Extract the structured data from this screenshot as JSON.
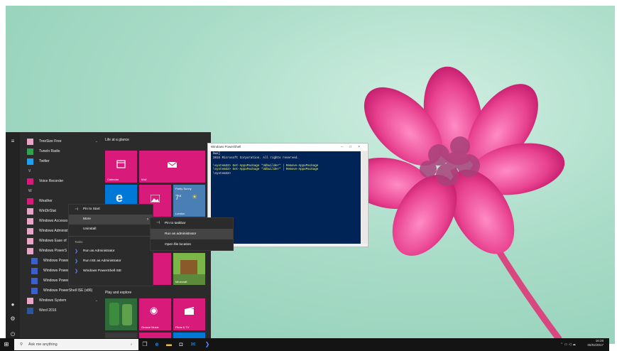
{
  "start_menu": {
    "app_list": [
      {
        "type": "app",
        "label": "TreeSize Free",
        "color": "#e8a5c8",
        "chevron": "⌄"
      },
      {
        "type": "app",
        "label": "Tuneln Radio",
        "color": "#2ea44f"
      },
      {
        "type": "app",
        "label": "Twitter",
        "color": "#1da1f2"
      },
      {
        "type": "letter",
        "label": "V"
      },
      {
        "type": "app",
        "label": "Voice Recorder",
        "color": "#d81b7a"
      },
      {
        "type": "letter",
        "label": "W"
      },
      {
        "type": "app",
        "label": "Weather",
        "color": "#d81b7a"
      },
      {
        "type": "app",
        "label": "WinDirStat",
        "color": "#e8a5c8"
      },
      {
        "type": "app",
        "label": "Windows Accesso",
        "color": "#e8a5c8"
      },
      {
        "type": "app",
        "label": "Windows Administ",
        "color": "#e8a5c8"
      },
      {
        "type": "app",
        "label": "Windows Ease of",
        "color": "#e8a5c8"
      },
      {
        "type": "app",
        "label": "Windows PowerS",
        "color": "#e8a5c8"
      },
      {
        "type": "app",
        "label": "Windows PowerShell",
        "color": "#3b5fcc",
        "indent": true
      },
      {
        "type": "app",
        "label": "Windows PowerShell (x86)",
        "color": "#3b5fcc",
        "indent": true
      },
      {
        "type": "app",
        "label": "Windows PowerShell ISE",
        "color": "#3b5fcc",
        "indent": true
      },
      {
        "type": "app",
        "label": "Windows PowerShell ISE (x86)",
        "color": "#3b5fcc",
        "indent": true
      },
      {
        "type": "app",
        "label": "Windows System",
        "color": "#e8a5c8",
        "chevron": "⌄"
      },
      {
        "type": "app",
        "label": "Word 2016",
        "color": "#2b579a"
      }
    ],
    "groups": {
      "life": "Life at a glance",
      "play": "Play and explore"
    },
    "tiles": {
      "calendar": "Calendar",
      "mail": "Mail",
      "weather_desc": "Partly Sunny",
      "weather_temp": "7°",
      "weather_city": "London",
      "minecraft": "Minecraft",
      "groove": "Groove Music",
      "films": "Films & TV"
    }
  },
  "context_menu": {
    "pin_start": "Pin to Start",
    "more": "More",
    "uninstall": "Uninstall",
    "tasks_header": "Tasks",
    "tasks": [
      "Run as Administrator",
      "Run ISE as Administrator",
      "Windows PowerShell ISE"
    ]
  },
  "submenu": {
    "pin_taskbar": "Pin to taskbar",
    "run_admin": "Run as administrator",
    "open_location": "Open file location"
  },
  "powershell": {
    "title": "Windows PowerShell",
    "lines": [
      {
        "text": "bws]",
        "cls": ""
      },
      {
        "text": "2016 Microsoft Corporation. All rights reserved.",
        "cls": ""
      },
      {
        "text": "",
        "cls": ""
      },
      {
        "text": "\\system32> Get-AppxPackage *3dbuilder* | Remove-AppxPackage",
        "cls": "cmd"
      },
      {
        "text": "\\system32> Get-AppxPackage *3dbuilder* | Remove-AppxPackage",
        "cls": "cmd"
      },
      {
        "text": "\\system32>",
        "cls": ""
      }
    ]
  },
  "taskbar": {
    "search_placeholder": "Ask me anything",
    "time": "16:28",
    "date": "05/02/2017"
  },
  "colors": {
    "accent": "#d81b7a",
    "ps_bg": "#012456",
    "taskbar": "#141414"
  }
}
